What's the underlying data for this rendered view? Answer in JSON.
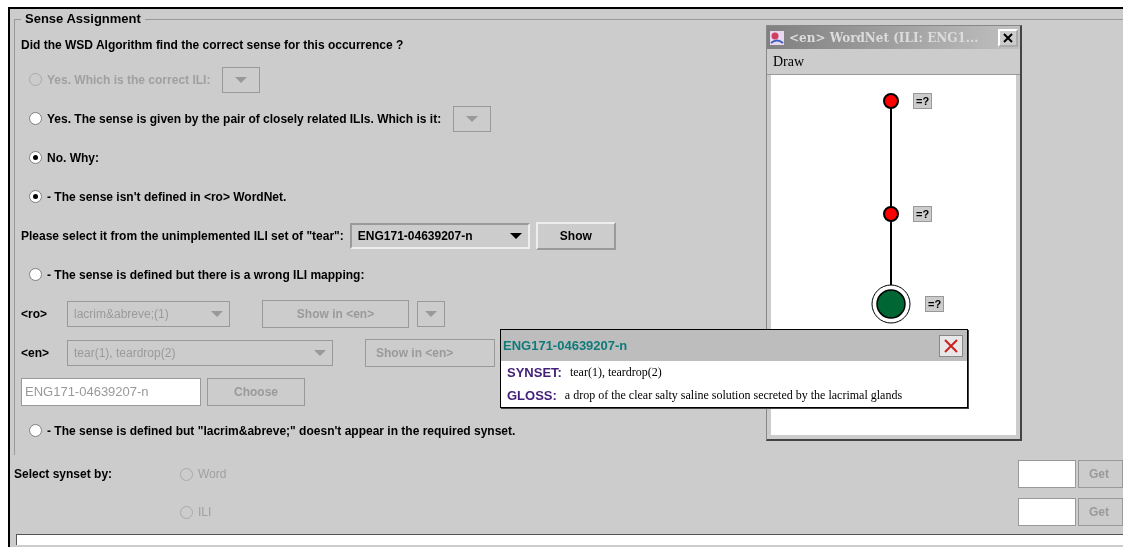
{
  "panel": {
    "title": "Sense Assignment"
  },
  "question": "Did the WSD Algorithm find the correct sense for this occurrence ?",
  "yes_correct": {
    "label": "Yes. Which is the correct ILI:",
    "selected": false,
    "disabled": true
  },
  "yes_pair": {
    "label": "Yes. The sense is given by the pair of closely related ILIs. Which is it:",
    "selected": false,
    "disabled": false
  },
  "no": {
    "label": "No. Why:",
    "selected": true,
    "disabled": false
  },
  "not_defined": {
    "label": "- The sense isn't defined in <ro> WordNet.",
    "selected": true,
    "disabled": false
  },
  "unimplemented": {
    "label": "Please select it from the unimplemented ILI set of \"tear\":",
    "combo": "ENG171-04639207-n",
    "button": "Show"
  },
  "wrong_mapping": {
    "label": "- The sense is defined but there is a wrong ILI mapping:",
    "selected": false,
    "disabled": false
  },
  "ro_row": {
    "label": "<ro>",
    "combo": "lacrim&abreve;(1)",
    "button": "Show in <en>",
    "disabled": true
  },
  "en_row": {
    "label": "<en>",
    "combo": "tear(1), teardrop(2)",
    "button": "Show in <en>",
    "disabled": true
  },
  "ili_field": {
    "value": "ENG171-04639207-n",
    "button": "Choose",
    "disabled": true
  },
  "not_in_synset": {
    "label": "- The sense is defined but \"lacrim&abreve;\" doesn't appear in the required synset.",
    "selected": false,
    "disabled": false
  },
  "select_by": {
    "label": "Select synset by:",
    "options": [
      {
        "label": "Word",
        "selected": false,
        "disabled": true
      },
      {
        "label": "ILI",
        "selected": false,
        "disabled": true
      }
    ]
  },
  "get_buttons": [
    "Get",
    "Get"
  ],
  "wordnet_window": {
    "title": "<en> WordNet (ILI: ENG1...",
    "menu": [
      "Draw"
    ],
    "nodes": [
      {
        "label": "=?",
        "color": "#ff0000"
      },
      {
        "label": "=?",
        "color": "#ff0000"
      },
      {
        "label": "=?",
        "color": "#006633"
      }
    ]
  },
  "popup": {
    "title": "ENG171-04639207-n",
    "synset_label": "SYNSET:",
    "synset": "tear(1), teardrop(2)",
    "gloss_label": "GLOSS:",
    "gloss": "a drop of the clear salty saline solution secreted by the lacrimal glands"
  }
}
